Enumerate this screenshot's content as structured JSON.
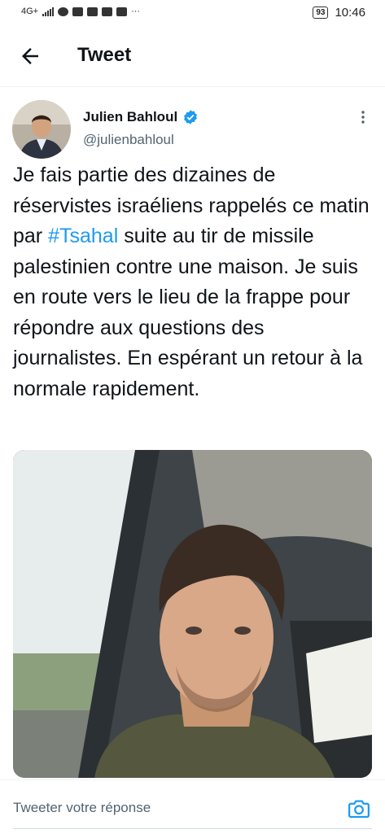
{
  "status_bar": {
    "network": "4G+",
    "battery": "93",
    "time": "10:46"
  },
  "header": {
    "title": "Tweet"
  },
  "tweet": {
    "author_name": "Julien Bahloul",
    "handle": "@julienbahloul",
    "text_before": "Je fais partie des dizaines de réservistes israéliens rappelés ce matin par ",
    "hashtag": "#Tsahal",
    "text_after": " suite au tir de missile palestinien contre une maison. Je suis en route vers le lieu de la frappe pour répondre aux questions des journalistes. En espérant un retour à la normale rapidement."
  },
  "reply": {
    "placeholder": "Tweeter votre réponse"
  },
  "colors": {
    "accent": "#1d9bf0",
    "text": "#0f1419",
    "muted": "#536471"
  },
  "icons": [
    "back-arrow-icon",
    "verified-badge-icon",
    "more-vertical-icon",
    "camera-icon"
  ]
}
